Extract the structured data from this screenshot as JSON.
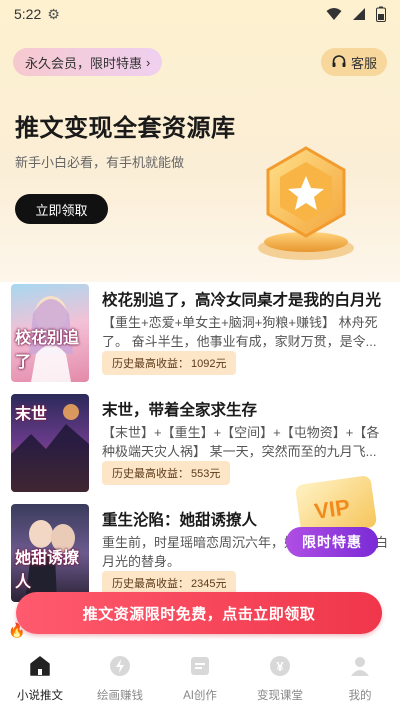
{
  "status": {
    "time": "5:22"
  },
  "header": {
    "vip_label": "永久会员，限时特惠",
    "vip_arrow": "›",
    "service_label": "客服",
    "title": "推文变现全套资源库",
    "subtitle": "新手小白必看，有手机就能做",
    "claim_button": "立即领取"
  },
  "books": [
    {
      "cover_text": "校花别追了",
      "title": "校花别追了，高冷女同桌才是我的白月光",
      "desc": "【重生+恋爱+单女主+脑洞+狗粮+赚钱】 林舟死了。 奋斗半生，他事业有成，家财万贯，是令...",
      "earn_label": "历史最高收益：",
      "earn_value": "1092元"
    },
    {
      "cover_text": "末世",
      "title": "末世，带着全家求生存",
      "desc": "【末世】+【重生】+【空间】+【屯物资】+【各种极端天灾人祸】 某一天，突然而至的九月飞...",
      "earn_label": "历史最高收益：",
      "earn_value": "553元"
    },
    {
      "cover_text": "她甜诱撩人",
      "title": "重生沦陷：她甜诱撩人",
      "desc": "重生前，时星瑶暗恋周沉六年，她，只把她当成白月光的替身。",
      "earn_label": "历史最高收益：",
      "earn_value": "2345元"
    }
  ],
  "float_badge": {
    "vip_text": "VIP",
    "label": "限时特惠"
  },
  "promo_banner": "推文资源限时免费，点击立即领取",
  "tabs": [
    {
      "label": "小说推文",
      "icon": "home-icon",
      "active": true
    },
    {
      "label": "绘画赚钱",
      "icon": "bolt-icon",
      "active": false
    },
    {
      "label": "AI创作",
      "icon": "ai-doc-icon",
      "active": false
    },
    {
      "label": "变现课堂",
      "icon": "yen-icon",
      "active": false
    },
    {
      "label": "我的",
      "icon": "profile-icon",
      "active": false
    }
  ],
  "colors": {
    "accent_red": "#f0364a",
    "vip_purple": "#9b3ee0",
    "hero_bg": "#fdf1cf",
    "earn_badge_bg": "#fde6c8"
  }
}
